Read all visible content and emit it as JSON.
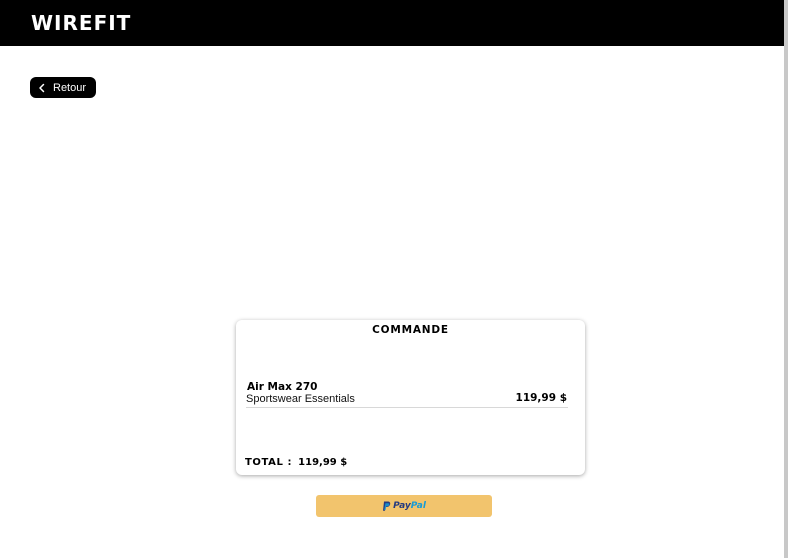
{
  "header": {
    "logo": "WIREFIT"
  },
  "nav": {
    "back_label": "Retour"
  },
  "order": {
    "title": "COMMANDE",
    "items": [
      {
        "name": "Air Max 270",
        "brand": "Sportswear Essentials",
        "price": "119,99 $"
      }
    ],
    "total_label": "TOTAL :",
    "total_value": "119,99 $"
  },
  "payment": {
    "paypal_pay": "Pay",
    "paypal_pal": "Pal",
    "button_color": "#f2c46d"
  },
  "icons": {
    "back": "chevron-left-icon",
    "paypal": "paypal-icon"
  }
}
